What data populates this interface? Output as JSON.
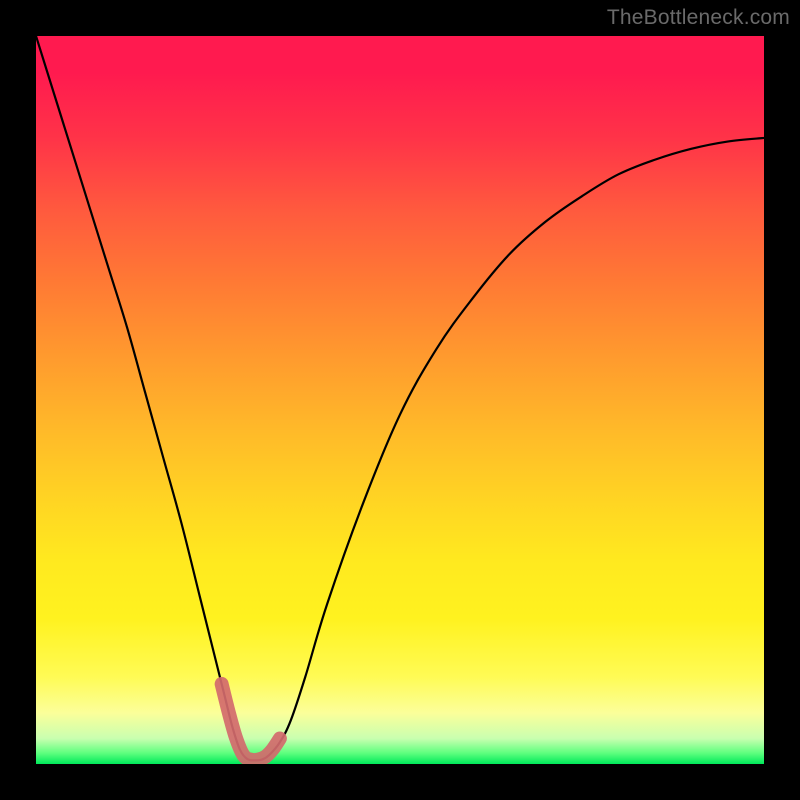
{
  "watermark": {
    "text": "TheBottleneck.com"
  },
  "colors": {
    "curve_stroke": "#000000",
    "highlight_stroke": "#d36a6d",
    "background_black": "#000000"
  },
  "chart_data": {
    "type": "line",
    "title": "",
    "xlabel": "",
    "ylabel": "",
    "xlim": [
      0,
      100
    ],
    "ylim": [
      0,
      100
    ],
    "grid": false,
    "legend": false,
    "series": [
      {
        "name": "bottleneck-curve",
        "x": [
          0,
          2.5,
          5,
          7.5,
          10,
          12.5,
          15,
          17.5,
          20,
          22.5,
          25,
          26,
          27,
          28,
          29,
          30,
          31,
          32,
          33.5,
          35,
          37,
          40,
          45,
          50,
          55,
          60,
          65,
          70,
          75,
          80,
          85,
          90,
          95,
          100
        ],
        "y": [
          100,
          92,
          84,
          76,
          68,
          60,
          51,
          42,
          33,
          23,
          13,
          9,
          5,
          2,
          0.7,
          0.5,
          0.6,
          1.2,
          3,
          6,
          12,
          22,
          36,
          48,
          57,
          64,
          70,
          74.5,
          78,
          81,
          83,
          84.5,
          85.5,
          86
        ]
      },
      {
        "name": "optimal-zone-highlight",
        "x": [
          25.5,
          26.5,
          27.5,
          28.5,
          29.5,
          30.5,
          31.5,
          32.5,
          33.5
        ],
        "y": [
          11,
          7,
          3.5,
          1.2,
          0.6,
          0.6,
          1,
          2,
          3.5
        ]
      }
    ]
  }
}
